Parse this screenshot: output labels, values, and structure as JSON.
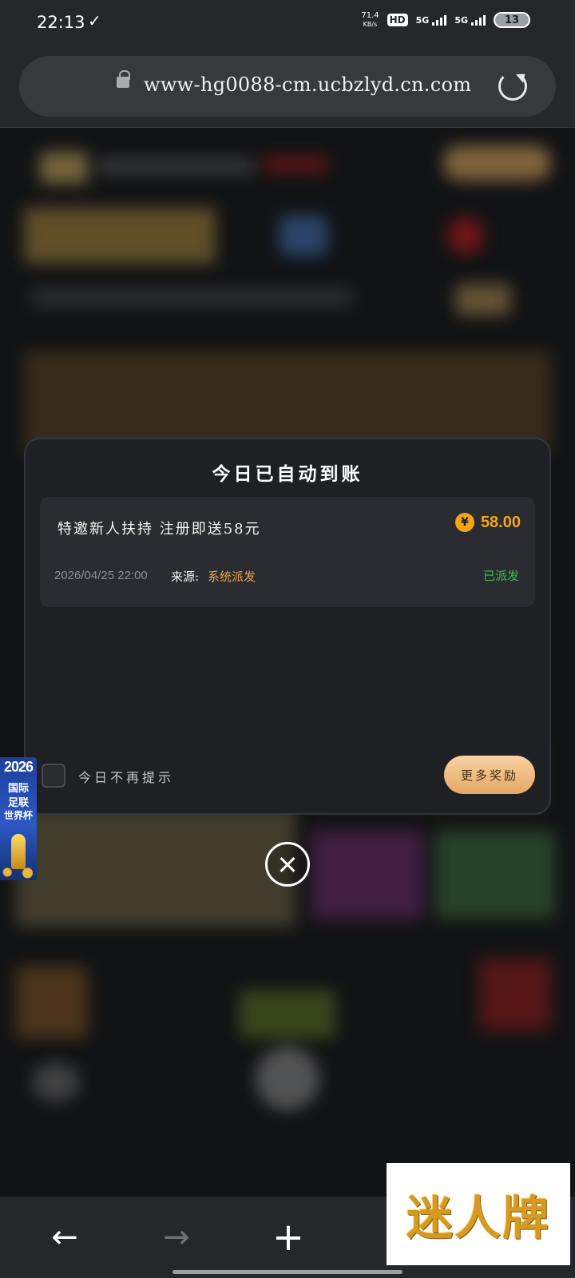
{
  "status_bar": {
    "time": "22:13",
    "check_glyph": "✓",
    "net_speed_value": "71.4",
    "net_speed_unit": "KB/s",
    "hd": "HD",
    "sim1": "5G",
    "sim2": "5G",
    "battery": "13"
  },
  "browser": {
    "url": "www-hg0088-cm.ucbzlyd.cn.com"
  },
  "modal": {
    "title": "今日已自动到账",
    "item": {
      "title": "特邀新人扶持 注册即送58元",
      "currency_symbol": "¥",
      "amount": "58.00",
      "date": "2026/04/25 22:00",
      "source_label": "来源:",
      "source_value": "系统派发",
      "status": "已派发"
    },
    "dont_show_today": "今日不再提示",
    "more_rewards": "更多奖励"
  },
  "side_badge": {
    "year": "2026",
    "line1": "国际",
    "line2": "足联",
    "line3": "世界杯"
  },
  "bottom_nav": {
    "back": "←",
    "forward": "→",
    "add": "+"
  },
  "watermark": {
    "text": "迷人牌"
  },
  "colors": {
    "accent_gold": "#f5a416",
    "status_green": "#35c24a",
    "source_orange": "#e5a44b"
  }
}
